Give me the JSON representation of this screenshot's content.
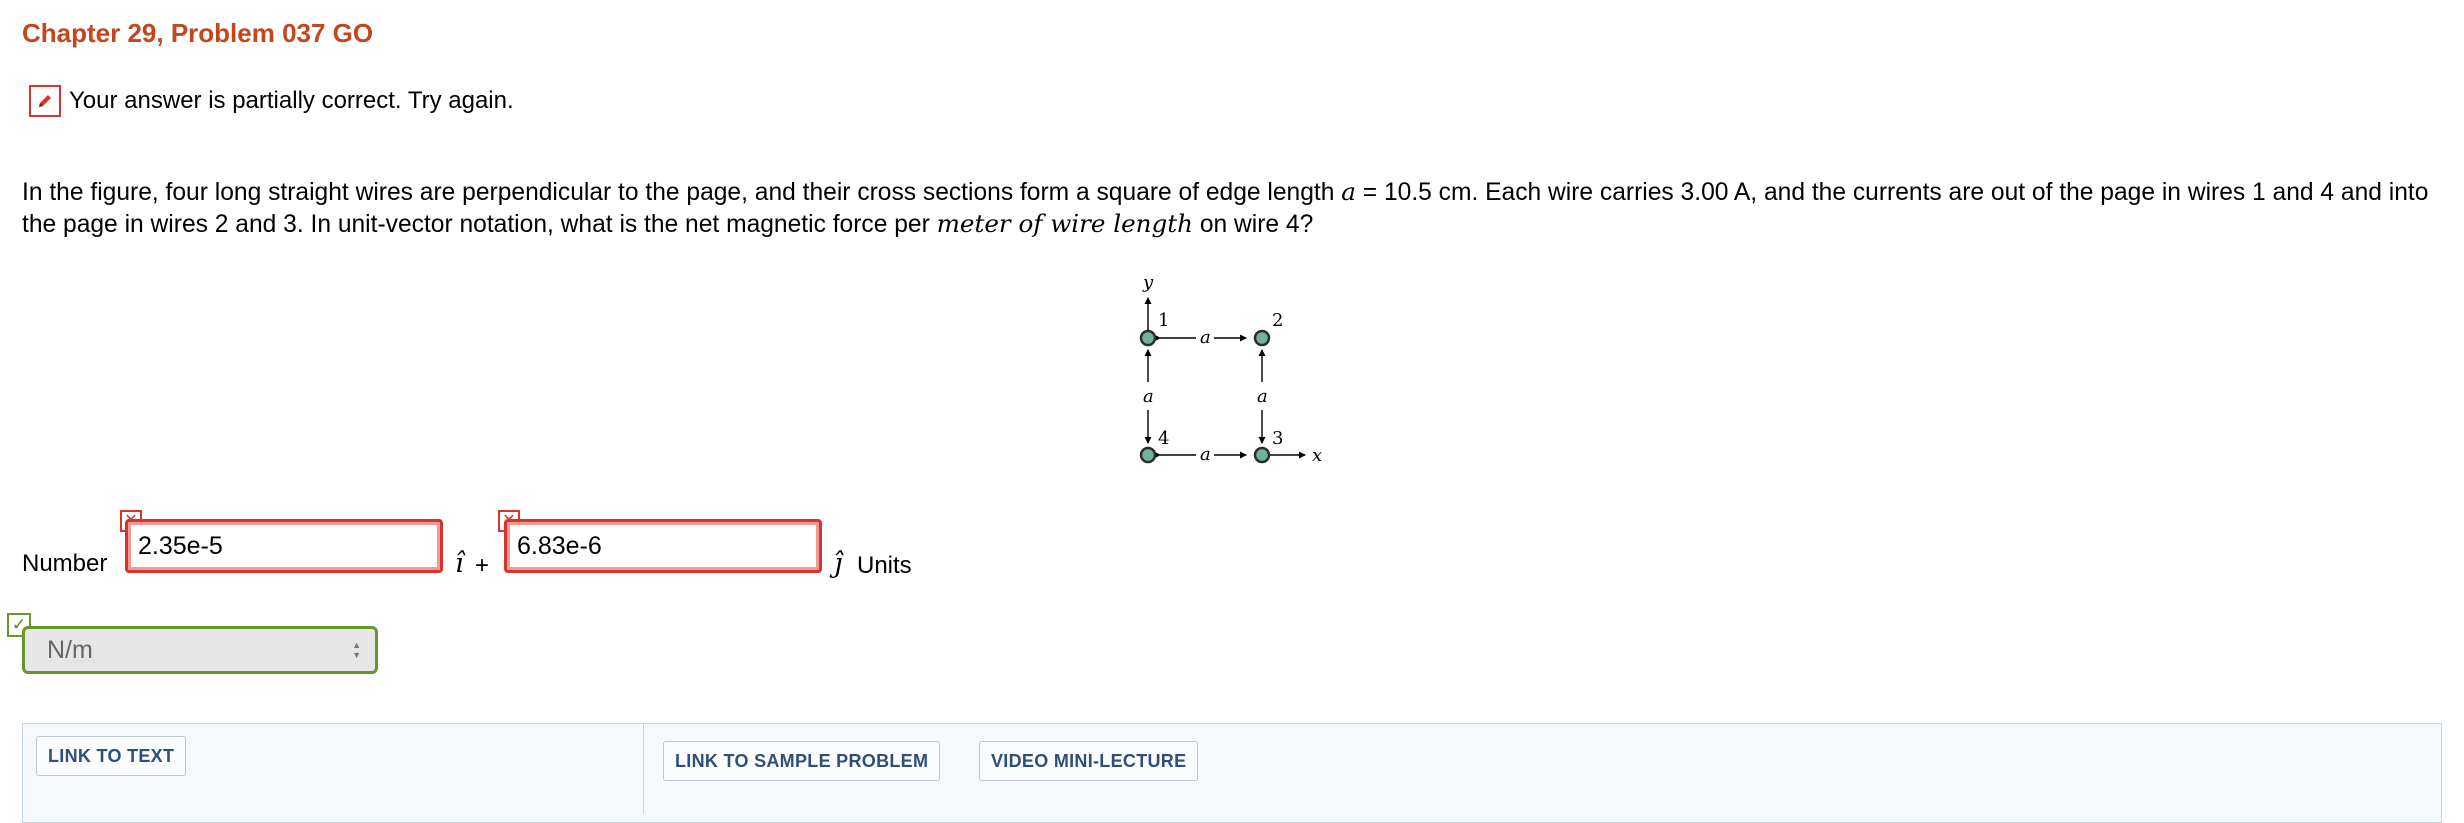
{
  "header": {
    "title": "Chapter 29, Problem 037 GO"
  },
  "feedback": {
    "message": "Your answer is partially correct.  Try again."
  },
  "problem": {
    "text_1": "In the figure, four long straight wires are perpendicular to the page, and their cross sections form a square of edge length ",
    "var_a": "a",
    "text_2": " = 10.5 cm. Each wire carries 3.00 A, and the currents are out of the page in wires 1 and 4 and into the page in wires 2 and 3. In unit-vector notation, what is the net magnetic force per ",
    "emphasis": "meter of wire length",
    "text_3": " on wire 4?"
  },
  "figure": {
    "axis_y": "y",
    "axis_x": "x",
    "edge_label": "a",
    "wire_labels": [
      "1",
      "2",
      "3",
      "4"
    ]
  },
  "answer": {
    "number_label": "Number",
    "i_component": "2.35e-5",
    "j_component": "6.83e-6",
    "i_hat": "î",
    "j_hat": "ĵ",
    "plus": "+",
    "units_label": "Units",
    "units_selected": "N/m",
    "status_i": "incorrect",
    "status_j": "incorrect",
    "status_units": "correct",
    "wrong_mark": "✕",
    "correct_mark": "✓"
  },
  "resources": {
    "link_to_text": "LINK TO TEXT",
    "link_to_sample_problem": "LINK TO SAMPLE PROBLEM",
    "video_mini_lecture": "VIDEO MINI-LECTURE"
  },
  "colors": {
    "title": "#c4461c",
    "error_border": "#d9342b",
    "correct_border": "#67962c",
    "wire_fill": "#6fb39a",
    "button_text": "#2f4f7a"
  }
}
